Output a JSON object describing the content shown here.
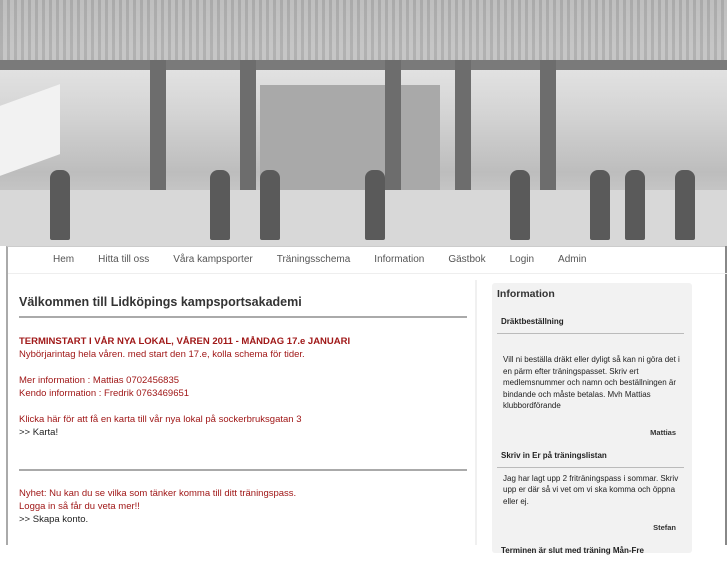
{
  "nav": [
    "Hem",
    "Hitta till oss",
    "Våra kampsporter",
    "Träningsschema",
    "Information",
    "Gästbok",
    "Login",
    "Admin"
  ],
  "main": {
    "title": "Välkommen till Lidköpings kampsportsakademi",
    "headline": "TERMINSTART I VÅR NYA LOKAL, VÅREN 2011 - MÅNDAG 17.e JANUARI",
    "line1": "Nybörjarintag hela våren. med start den 17.e, kolla schema för tider.",
    "info1": "Mer information : Mattias 0702456835",
    "info2": "Kendo information : Fredrik 0763469651",
    "map_text": "Klicka här för att få en karta till vår nya lokal på sockerbruksgatan 3",
    "map_link": ">> Karta!",
    "news1": "Nyhet: Nu kan du se vilka som tänker komma till ditt träningspass.",
    "news2": "Logga in så får du veta mer!!",
    "account_link": ">> Skapa konto."
  },
  "sidebar": {
    "title": "Information",
    "posts": [
      {
        "title": "Dräktbeställning",
        "body": "Vill ni beställa dräkt eller dyligt så kan ni göra det i en pärm efter träningspasset. Skriv ert medlemsnummer och namn och beställningen är bindande och måste betalas. Mvh Mattias klubbordförande",
        "author": "Mattias"
      },
      {
        "title": "Skriv in Er på träningslistan",
        "body": "Jag har lagt upp 2 friträningspass i sommar. Skriv upp er där så vi vet om vi ska komma och öppna eller ej.",
        "author": "Stefan"
      },
      {
        "title": "Terminen är slut med träning Mån-Fre"
      }
    ]
  }
}
